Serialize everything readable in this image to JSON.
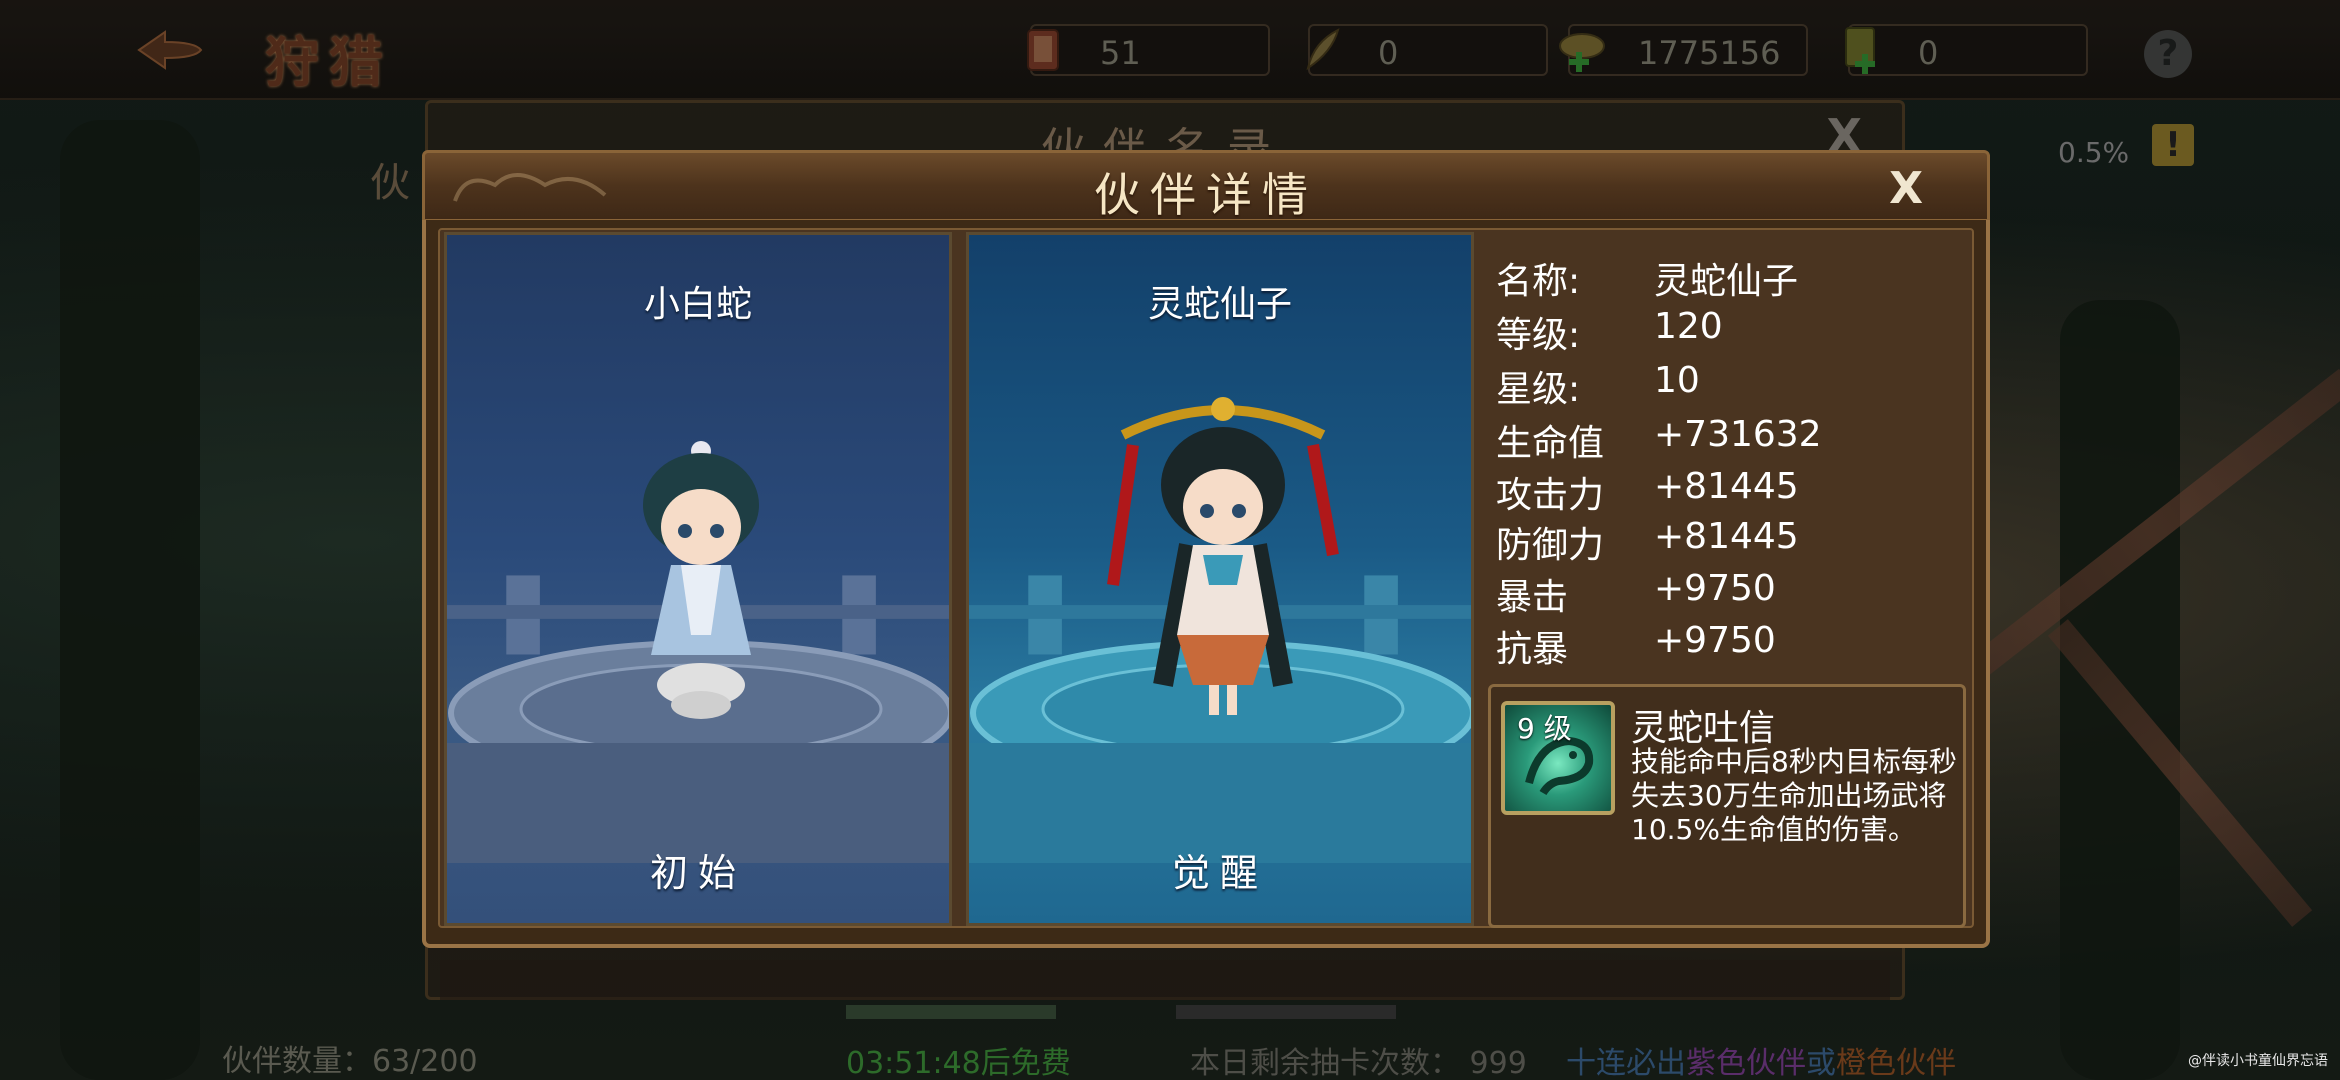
{
  "topbar": {
    "title": "狩猎",
    "resources": [
      {
        "icon": "scroll-icon",
        "value": "51"
      },
      {
        "icon": "quill-icon",
        "value": "0"
      },
      {
        "icon": "coins-plus-icon",
        "value": "1775156"
      },
      {
        "icon": "ticket-plus-icon",
        "value": "0"
      }
    ],
    "help": "?"
  },
  "background_panel": {
    "title": "伙伴名录",
    "close": "X",
    "side_label": "伙",
    "percent": "0.5%",
    "warning": "!",
    "count": "伙伴数量：63/200",
    "timer": "03:51:48后免费",
    "draws_left": "本日剩余抽卡次数：  999",
    "promo_prefix": "十连必出",
    "promo_purple": "紫色伙伴",
    "promo_or": "或",
    "promo_orange": "橙色伙伴"
  },
  "dialog": {
    "title": "伙伴详情",
    "close": "X",
    "cards": [
      {
        "name": "小白蛇",
        "stage": "初始"
      },
      {
        "name": "灵蛇仙子",
        "stage": "觉醒"
      }
    ],
    "stats": [
      {
        "label": "名称:",
        "value": "灵蛇仙子"
      },
      {
        "label": "等级:",
        "value": "120"
      },
      {
        "label": "星级:",
        "value": "10"
      },
      {
        "label": "生命值",
        "value": "+731632"
      },
      {
        "label": "攻击力",
        "value": "+81445"
      },
      {
        "label": "防御力",
        "value": "+81445"
      },
      {
        "label": "暴击",
        "value": "+9750"
      },
      {
        "label": "抗暴",
        "value": "+9750"
      }
    ],
    "skill": {
      "level": "9 级",
      "name": "灵蛇吐信",
      "description": "技能命中后8秒内目标每秒失去30万生命加出场武将10.5%生命值的伤害。"
    }
  },
  "watermark": "@伴读小书童仙界忘语"
}
